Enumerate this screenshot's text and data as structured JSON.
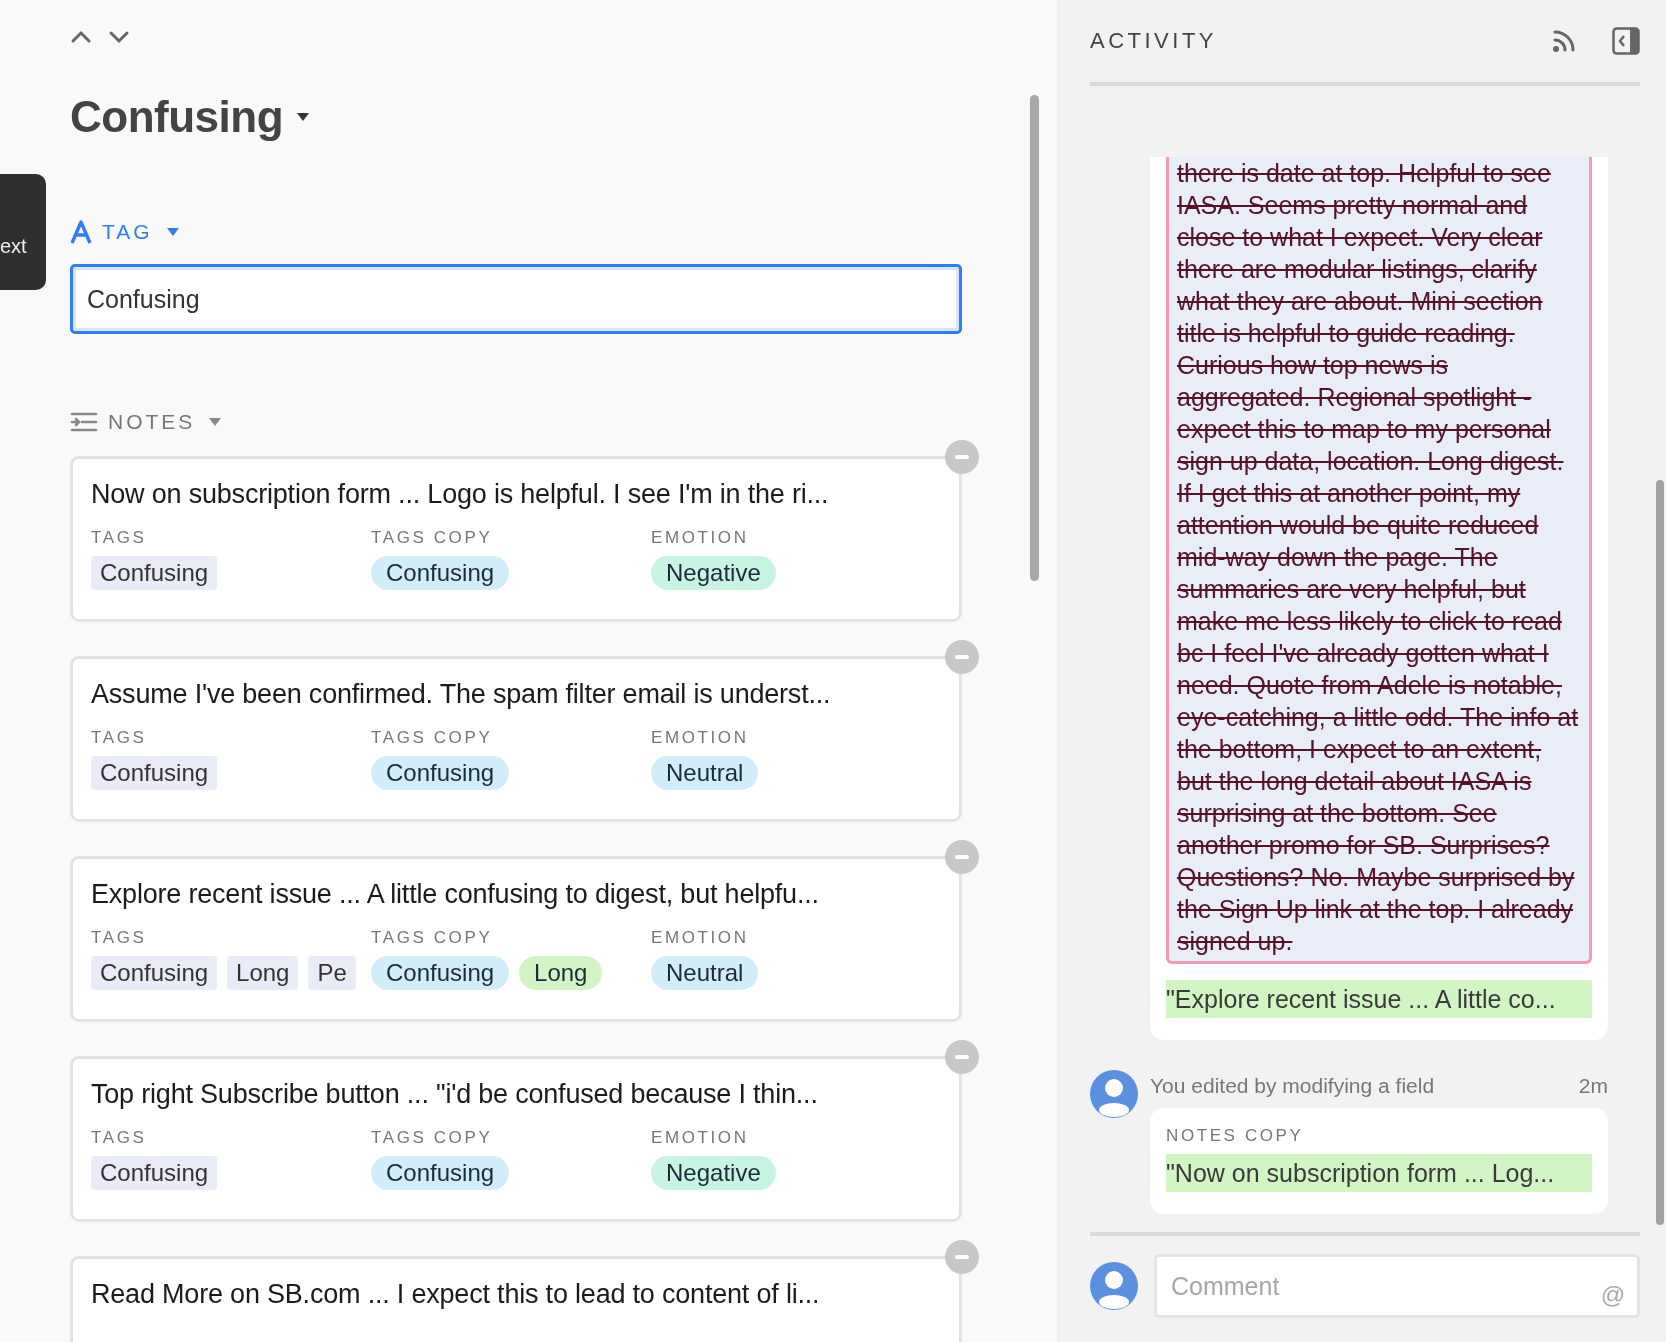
{
  "side_tab": {
    "label": "ext"
  },
  "record": {
    "title": "Confusing"
  },
  "tag_field": {
    "label": "TAG",
    "value": "Confusing"
  },
  "notes": {
    "label": "NOTES",
    "cards": [
      {
        "title": "Now on subscription form ... Logo is helpful. I see I'm in the ri...",
        "fields": [
          {
            "label": "TAGS",
            "kind": "tags",
            "chips": [
              {
                "text": "Confusing",
                "color": "#e9ecf7"
              }
            ]
          },
          {
            "label": "TAGS COPY",
            "kind": "select",
            "chips": [
              {
                "text": "Confusing",
                "color": "#d2edfa"
              }
            ]
          },
          {
            "label": "EMOTION",
            "kind": "select",
            "chips": [
              {
                "text": "Negative",
                "color": "#c8f4e3"
              }
            ]
          }
        ]
      },
      {
        "title": "Assume I've been confirmed. The spam filter email is underst...",
        "fields": [
          {
            "label": "TAGS",
            "kind": "tags",
            "chips": [
              {
                "text": "Confusing",
                "color": "#e9ecf7"
              }
            ]
          },
          {
            "label": "TAGS COPY",
            "kind": "select",
            "chips": [
              {
                "text": "Confusing",
                "color": "#d2edfa"
              }
            ]
          },
          {
            "label": "EMOTION",
            "kind": "select",
            "chips": [
              {
                "text": "Neutral",
                "color": "#d2edfa"
              }
            ]
          }
        ]
      },
      {
        "title": "Explore recent issue ... A little confusing to digest, but helpfu...",
        "fields": [
          {
            "label": "TAGS",
            "kind": "tags",
            "chips": [
              {
                "text": "Confusing",
                "color": "#e9ecf7"
              },
              {
                "text": "Long",
                "color": "#e9ecf7"
              },
              {
                "text": "Pe",
                "color": "#e9ecf7"
              }
            ]
          },
          {
            "label": "TAGS COPY",
            "kind": "select",
            "chips": [
              {
                "text": "Confusing",
                "color": "#d2edfa"
              },
              {
                "text": "Long",
                "color": "#d3f5c5"
              }
            ]
          },
          {
            "label": "EMOTION",
            "kind": "select",
            "chips": [
              {
                "text": "Neutral",
                "color": "#d2edfa"
              }
            ]
          }
        ]
      },
      {
        "title": "Top right Subscribe button ... \"i'd be confused because I thin...",
        "fields": [
          {
            "label": "TAGS",
            "kind": "tags",
            "chips": [
              {
                "text": "Confusing",
                "color": "#e9ecf7"
              }
            ]
          },
          {
            "label": "TAGS COPY",
            "kind": "select",
            "chips": [
              {
                "text": "Confusing",
                "color": "#d2edfa"
              }
            ]
          },
          {
            "label": "EMOTION",
            "kind": "select",
            "chips": [
              {
                "text": "Negative",
                "color": "#c8f4e3"
              }
            ]
          }
        ]
      },
      {
        "title": "Read More on SB.com ... I expect this to lead to content of li..."
      }
    ]
  },
  "activity": {
    "title": "ACTIVITY",
    "feed": [
      {
        "kind": "change",
        "removed_text": "there is date at top. Helpful to see IASA. Seems pretty normal and close to what I expect. Very clear there are modular listings, clarify what they are about. Mini section title is helpful to guide reading. Curious how top news is aggregated. Regional spotlight - expect this to map to my personal sign up data, location. Long digest. If I get this at another point, my attention would be quite reduced mid-way down the page. The summaries are very helpful, but make me less likely to click to read bc I feel I've already gotten what I need. Quote from Adele is notable, eye-catching, a little odd. The info at the bottom, I expect to an extent, but the long detail about IASA is surprising at the bottom. See another promo for SB. Surprises? Questions? No. Maybe surprised by the Sign Up link at the top. I already signed up.",
        "added_text": "\"Explore recent issue ... A little co..."
      },
      {
        "kind": "edit",
        "summary": "You edited by modifying a field",
        "time": "2m",
        "field_label": "NOTES COPY",
        "added_text": "\"Now on subscription form ... Log..."
      }
    ],
    "comment": {
      "placeholder": "Comment",
      "mention_symbol": "@"
    }
  }
}
